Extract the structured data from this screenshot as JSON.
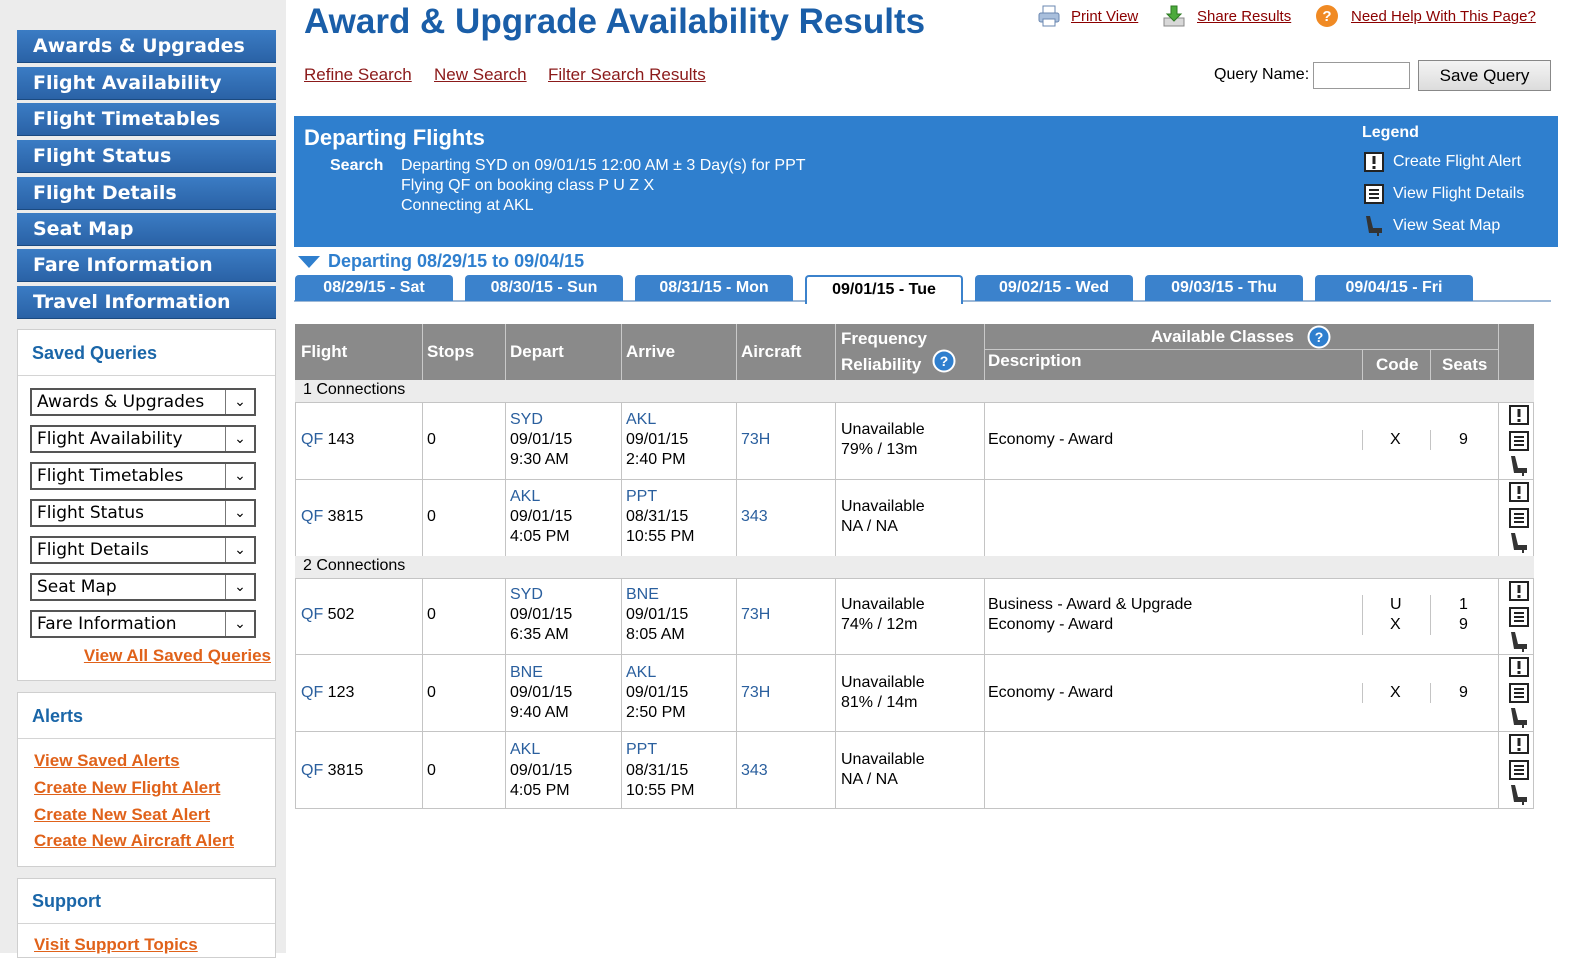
{
  "sidebar": {
    "nav_items": [
      "Awards & Upgrades",
      "Flight Availability",
      "Flight Timetables",
      "Flight Status",
      "Flight Details",
      "Seat Map",
      "Fare Information",
      "Travel Information"
    ],
    "saved_queries": {
      "title": "Saved Queries",
      "selects": [
        "Awards & Upgrades",
        "Flight Availability",
        "Flight Timetables",
        "Flight Status",
        "Flight Details",
        "Seat Map",
        "Fare Information"
      ],
      "view_all": "View All Saved Queries"
    },
    "alerts": {
      "title": "Alerts",
      "links": [
        "View Saved Alerts",
        "Create New Flight Alert",
        "Create New Seat Alert",
        "Create New Aircraft Alert"
      ]
    },
    "support": {
      "title": "Support",
      "link": "Visit Support Topics"
    }
  },
  "header": {
    "title": "Award & Upgrade Availability Results",
    "print": "Print View",
    "share": "Share Results",
    "help": "Need Help With This Page?",
    "refine": "Refine Search",
    "new_search": "New Search",
    "filter": "Filter Search Results",
    "query_label": "Query Name:",
    "save_query": "Save Query"
  },
  "banner": {
    "title": "Departing Flights",
    "search_label": "Search",
    "search_lines": [
      "Departing SYD on 09/01/15 12:00 AM ± 3 Day(s) for PPT",
      "Flying QF on booking class P U Z X",
      "Connecting at AKL"
    ],
    "legend_title": "Legend",
    "legend_items": [
      "Create Flight Alert",
      "View Flight Details",
      "View Seat Map"
    ]
  },
  "range_label": "Departing 08/29/15 to 09/04/15",
  "tabs": [
    "08/29/15 - Sat",
    "08/30/15 - Sun",
    "08/31/15 - Mon",
    "09/01/15 - Tue",
    "09/02/15 - Wed",
    "09/03/15 - Thu",
    "09/04/15 - Fri"
  ],
  "active_tab": "09/01/15 - Tue",
  "table": {
    "headers": {
      "flight": "Flight",
      "stops": "Stops",
      "depart": "Depart",
      "arrive": "Arrive",
      "aircraft": "Aircraft",
      "freq1": "Frequency",
      "freq2": "Reliability",
      "available": "Available Classes",
      "description": "Description",
      "code": "Code",
      "seats": "Seats"
    },
    "groups": [
      {
        "label": "1 Connections",
        "rows": [
          {
            "carrier": "QF",
            "number": "143",
            "stops": "0",
            "dep_code": "SYD",
            "dep_date": "09/01/15",
            "dep_time": "9:30 AM",
            "arr_code": "AKL",
            "arr_date": "09/01/15",
            "arr_time": "2:40 PM",
            "aircraft": "73H",
            "status": "Unavailable",
            "reliability": "79% / 13m",
            "classes": [
              {
                "desc": "Economy - Award",
                "code": "X",
                "seats": "9"
              }
            ]
          },
          {
            "carrier": "QF",
            "number": "3815",
            "stops": "0",
            "dep_code": "AKL",
            "dep_date": "09/01/15",
            "dep_time": "4:05 PM",
            "arr_code": "PPT",
            "arr_date": "08/31/15",
            "arr_time": "10:55 PM",
            "aircraft": "343",
            "status": "Unavailable",
            "reliability": "NA / NA",
            "classes": []
          }
        ]
      },
      {
        "label": "2 Connections",
        "rows": [
          {
            "carrier": "QF",
            "number": "502",
            "stops": "0",
            "dep_code": "SYD",
            "dep_date": "09/01/15",
            "dep_time": "6:35 AM",
            "arr_code": "BNE",
            "arr_date": "09/01/15",
            "arr_time": "8:05 AM",
            "aircraft": "73H",
            "status": "Unavailable",
            "reliability": "74% / 12m",
            "classes": [
              {
                "desc": "Business - Award & Upgrade",
                "code": "U",
                "seats": "1"
              },
              {
                "desc": "Economy - Award",
                "code": "X",
                "seats": "9"
              }
            ]
          },
          {
            "carrier": "QF",
            "number": "123",
            "stops": "0",
            "dep_code": "BNE",
            "dep_date": "09/01/15",
            "dep_time": "9:40 AM",
            "arr_code": "AKL",
            "arr_date": "09/01/15",
            "arr_time": "2:50 PM",
            "aircraft": "73H",
            "status": "Unavailable",
            "reliability": "81% / 14m",
            "classes": [
              {
                "desc": "Economy - Award",
                "code": "X",
                "seats": "9"
              }
            ]
          },
          {
            "carrier": "QF",
            "number": "3815",
            "stops": "0",
            "dep_code": "AKL",
            "dep_date": "09/01/15",
            "dep_time": "4:05 PM",
            "arr_code": "PPT",
            "arr_date": "08/31/15",
            "arr_time": "10:55 PM",
            "aircraft": "343",
            "status": "Unavailable",
            "reliability": "NA / NA",
            "classes": []
          }
        ]
      }
    ]
  },
  "row_icons": [
    "alert-icon",
    "details-icon",
    "seat-icon"
  ],
  "colors": {
    "brand_blue": "#2f7fce",
    "title_blue": "#1a5ea8",
    "link_red": "#8b1a1a",
    "link_orange": "#e0621a",
    "header_gray": "#8a8a8a"
  }
}
